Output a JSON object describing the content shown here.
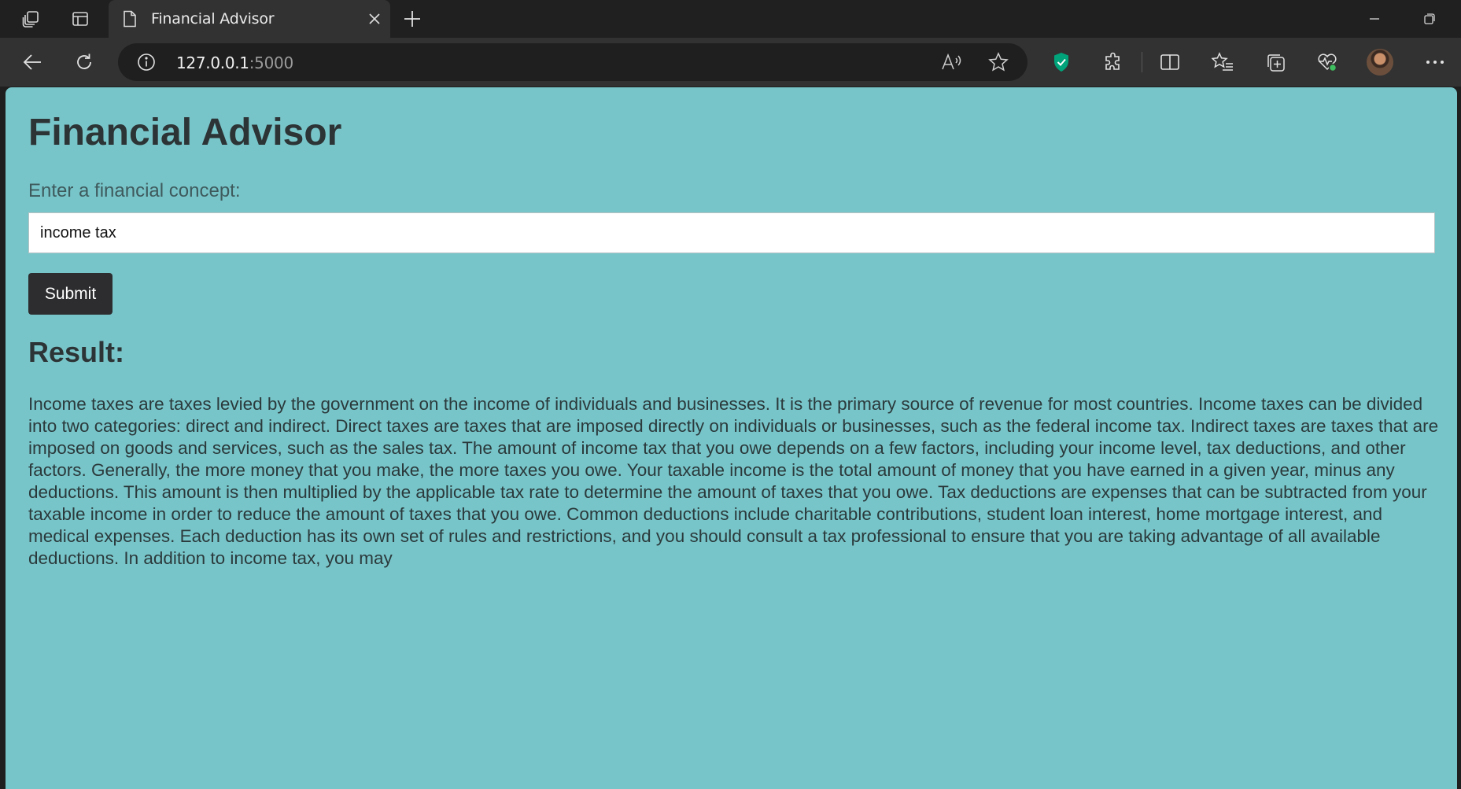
{
  "browser": {
    "tab": {
      "title": "Financial Advisor"
    },
    "address_bar": {
      "host": "127.0.0.1",
      "port": ":5000"
    }
  },
  "page": {
    "heading": "Financial Advisor",
    "input_label": "Enter a financial concept:",
    "input_value": "income tax",
    "submit_label": "Submit",
    "result_heading": "Result:",
    "result_text": "Income taxes are taxes levied by the government on the income of individuals and businesses. It is the primary source of revenue for most countries. Income taxes can be divided into two categories: direct and indirect. Direct taxes are taxes that are imposed directly on individuals or businesses, such as the federal income tax. Indirect taxes are taxes that are imposed on goods and services, such as the sales tax. The amount of income tax that you owe depends on a few factors, including your income level, tax deductions, and other factors. Generally, the more money that you make, the more taxes you owe. Your taxable income is the total amount of money that you have earned in a given year, minus any deductions. This amount is then multiplied by the applicable tax rate to determine the amount of taxes that you owe. Tax deductions are expenses that can be subtracted from your taxable income in order to reduce the amount of taxes that you owe. Common deductions include charitable contributions, student loan interest, home mortgage interest, and medical expenses. Each deduction has its own set of rules and restrictions, and you should consult a tax professional to ensure that you are taking advantage of all available deductions. In addition to income tax, you may"
  },
  "colors": {
    "page_background": "#78c5c9",
    "heading_text": "#2d3436",
    "button_background": "#2d2d2f",
    "browser_frame": "#202020",
    "toolbar": "#323232",
    "shield_accent": "#00a37a"
  },
  "icons": [
    "workspaces-icon",
    "tab-actions-icon",
    "page-icon",
    "close-icon",
    "new-tab-icon",
    "minimize-icon",
    "restore-icon",
    "back-icon",
    "refresh-icon",
    "info-icon",
    "read-aloud-icon",
    "favorite-star-icon",
    "shield-extension-icon",
    "extensions-icon",
    "split-screen-icon",
    "favorites-icon",
    "collections-icon",
    "browser-essentials-icon",
    "profile-avatar",
    "more-menu-icon"
  ]
}
